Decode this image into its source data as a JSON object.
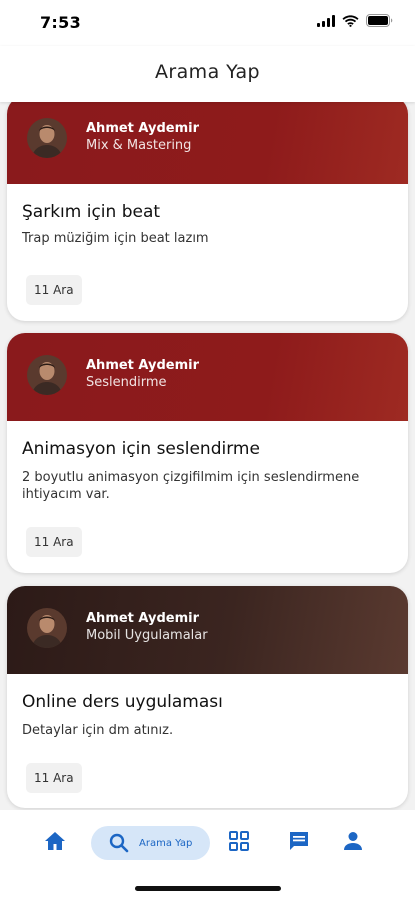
{
  "status_bar": {
    "time": "7:53"
  },
  "app_bar": {
    "title": "Arama Yap"
  },
  "colors": {
    "accent": "#1c66c4",
    "search_pill": "#d6e6f8",
    "card_header_red": "#8e1b1b",
    "card_header_brown": "#3b2520"
  },
  "cards": [
    {
      "author": "Ahmet Aydemir",
      "category": "Mix & Mastering",
      "title": "Şarkım için beat",
      "description": "Trap müziğim için beat lazım",
      "date": "11 Ara"
    },
    {
      "author": "Ahmet Aydemir",
      "category": "Seslendirme",
      "title": "Animasyon için seslendirme",
      "description": "2 boyutlu animasyon çizgifilmim için seslendirmene ihtiyacım var.",
      "date": "11 Ara"
    },
    {
      "author": "Ahmet Aydemir",
      "category": "Mobil Uygulamalar",
      "title": "Online ders uygulaması",
      "description": "Detaylar için dm atınız.",
      "date": "11 Ara"
    }
  ],
  "bottom_nav": {
    "items": [
      {
        "icon": "home-icon"
      },
      {
        "icon": "search-icon",
        "label": "Arama Yap",
        "active": true
      },
      {
        "icon": "grid-icon"
      },
      {
        "icon": "chat-icon"
      },
      {
        "icon": "person-icon"
      }
    ]
  }
}
